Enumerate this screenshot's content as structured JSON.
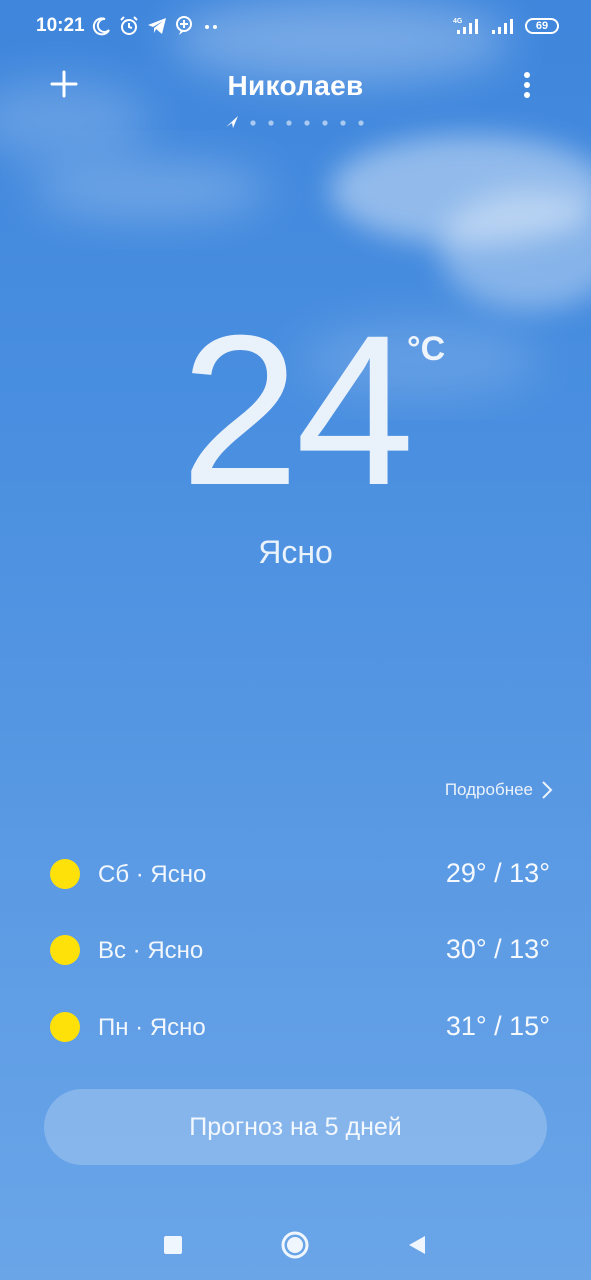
{
  "status_bar": {
    "time": "10:21",
    "left_icons": [
      "moon-icon",
      "alarm-icon",
      "telegram-icon",
      "messenger-icon",
      "more-dots-icon"
    ],
    "network_label": "4G",
    "battery": "69"
  },
  "header": {
    "city": "Николаев",
    "add_icon": "plus-icon",
    "menu_icon": "more-vertical-icon",
    "location_icon": "location-arrow-icon",
    "page_count": 7
  },
  "current": {
    "temperature": "24",
    "unit": "°C",
    "condition": "Ясно"
  },
  "details_link": "Подробнее",
  "forecast": [
    {
      "label": "Сб · Ясно",
      "temps": "29° / 13°",
      "icon": "sun-icon"
    },
    {
      "label": "Вс · Ясно",
      "temps": "30° / 13°",
      "icon": "sun-icon"
    },
    {
      "label": "Пн · Ясно",
      "temps": "31° / 15°",
      "icon": "sun-icon"
    }
  ],
  "forecast_button": "Прогноз на 5 дней",
  "nav": [
    "recents-icon",
    "home-icon",
    "back-icon"
  ],
  "colors": {
    "sky_top": "#3f86dc",
    "sky_bottom": "#6aa5e8",
    "sun": "#ffe10a"
  }
}
